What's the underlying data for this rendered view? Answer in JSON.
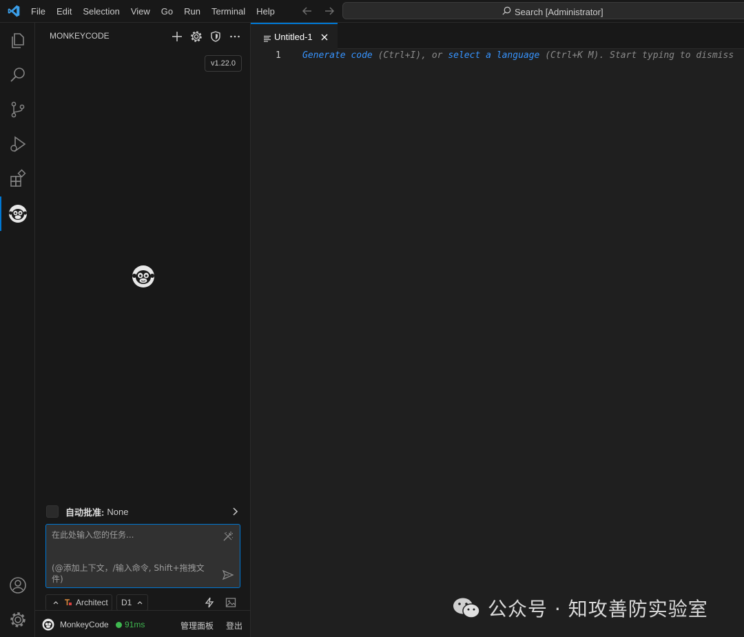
{
  "menu": [
    "File",
    "Edit",
    "Selection",
    "View",
    "Go",
    "Run",
    "Terminal",
    "Help"
  ],
  "search": {
    "label": "Search [Administrator]"
  },
  "sidebar": {
    "title": "MONKEYCODE",
    "version": "v1.22.0",
    "auto_approve_label": "自动批准:",
    "auto_approve_value": "None",
    "task_placeholder": "在此处输入您的任务...",
    "task_hint": "(@添加上下文，/输入命令, Shift+拖拽文件)",
    "mode": "Architect",
    "model": "D1",
    "status": {
      "name": "MonkeyCode",
      "latency": "91ms",
      "manage": "管理面板",
      "logout": "登出"
    }
  },
  "editor": {
    "tab_title": "Untitled-1",
    "line_number": "1",
    "hint": {
      "link1": "Generate code",
      "part1": " (Ctrl+I), or ",
      "link2": "select a language",
      "part2": " (Ctrl+K M). Start typing to dismiss"
    }
  },
  "watermark": {
    "text": "公众号 · 知攻善防实验室"
  },
  "colors": {
    "accent": "#0078d4",
    "link": "#3794ff",
    "online": "#3fb950"
  }
}
